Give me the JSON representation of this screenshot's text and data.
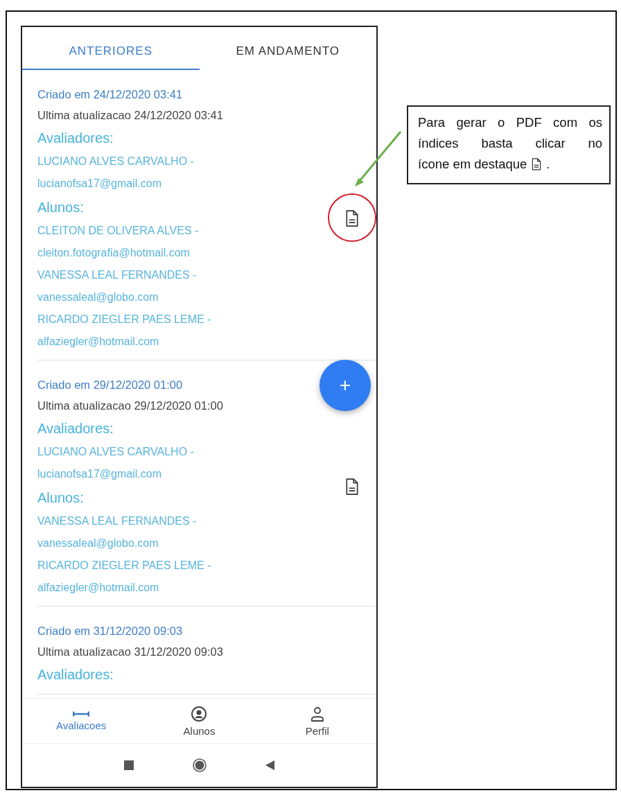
{
  "tabs": [
    {
      "label": "ANTERIORES",
      "selected": true
    },
    {
      "label": "EM ANDAMENTO",
      "selected": false
    }
  ],
  "evaluations": [
    {
      "created": "Criado em 24/12/2020 03:41",
      "updated": "Ultima atualizacao 24/12/2020 03:41",
      "evaluators_label": "Avaliadores:",
      "evaluators": [
        {
          "name": "LUCIANO ALVES CARVALHO -",
          "email": "lucianofsa17@gmail.com"
        }
      ],
      "students_label": "Alunos:",
      "students": [
        {
          "name": "CLEITON DE OLIVERA ALVES -",
          "email": "cleiton.fotografia@hotmail.com"
        },
        {
          "name": "VANESSA LEAL FERNANDES -",
          "email": "vanessaleal@globo.com"
        },
        {
          "name": "RICARDO ZIEGLER PAES LEME -",
          "email": "alfaziegler@hotmail.com"
        }
      ],
      "highlighted": true
    },
    {
      "created": "Criado em 29/12/2020 01:00",
      "updated": "Ultima atualizacao 29/12/2020 01:00",
      "evaluators_label": "Avaliadores:",
      "evaluators": [
        {
          "name": "LUCIANO ALVES CARVALHO -",
          "email": "lucianofsa17@gmail.com"
        }
      ],
      "students_label": "Alunos:",
      "students": [
        {
          "name": "VANESSA LEAL FERNANDES -",
          "email": "vanessaleal@globo.com"
        },
        {
          "name": "RICARDO ZIEGLER PAES LEME -",
          "email": "alfaziegler@hotmail.com"
        }
      ],
      "highlighted": false
    },
    {
      "created": "Criado em 31/12/2020 09:03",
      "updated": "Ultima atualizacao 31/12/2020 09:03",
      "evaluators_label": "Avaliadores:",
      "highlighted": false
    }
  ],
  "fab": {
    "label": "+"
  },
  "bottom_nav": [
    {
      "kind": "ruler",
      "label": "Avaliacoes",
      "selected": true
    },
    {
      "kind": "account",
      "label": "Alunos",
      "selected": false
    },
    {
      "kind": "person",
      "label": "Perfil",
      "selected": false
    }
  ],
  "callout": {
    "lines": [
      "Para gerar o PDF com os",
      "índices basta clicar no",
      "ícone em destaque"
    ],
    "end": "."
  }
}
